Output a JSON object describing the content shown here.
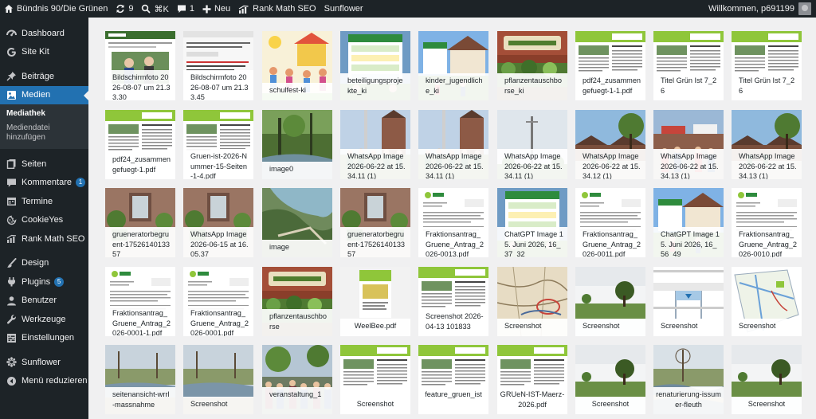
{
  "admin_bar": {
    "site_name": "Bündnis 90/Die Grünen",
    "updates_count": "9",
    "shortcut": "⌘K",
    "comments_count": "1",
    "new_label": "Neu",
    "rank_math_label": "Rank Math SEO",
    "sunflower_label": "Sunflower",
    "greeting": "Willkommen, p691199",
    "colors": {
      "background": "#1d2327",
      "text": "#f0f0f1"
    }
  },
  "sidebar": {
    "items": [
      {
        "label": "Dashboard",
        "icon": "dashboard-icon"
      },
      {
        "label": "Site Kit",
        "icon": "google-g-icon"
      },
      {
        "label": "Beiträge",
        "icon": "pushpin-icon"
      },
      {
        "label": "Medien",
        "icon": "media-icon",
        "current": true
      },
      {
        "label": "Seiten",
        "icon": "pages-icon"
      },
      {
        "label": "Kommentare",
        "icon": "comment-icon",
        "badge": "1"
      },
      {
        "label": "Termine",
        "icon": "calendar-icon"
      },
      {
        "label": "CookieYes",
        "icon": "cookie-icon"
      },
      {
        "label": "Rank Math SEO",
        "icon": "rank-math-icon"
      },
      {
        "label": "Design",
        "icon": "paintbrush-icon"
      },
      {
        "label": "Plugins",
        "icon": "plugin-icon",
        "badge": "5"
      },
      {
        "label": "Benutzer",
        "icon": "user-icon"
      },
      {
        "label": "Werkzeuge",
        "icon": "wrench-icon"
      },
      {
        "label": "Einstellungen",
        "icon": "settings-icon"
      },
      {
        "label": "Sunflower",
        "icon": "sunflower-icon"
      },
      {
        "label": "Menü reduzieren",
        "icon": "collapse-icon"
      }
    ],
    "submenu": [
      {
        "label": "Mediathek",
        "current": true
      },
      {
        "label": "Mediendatei hinzufügen"
      }
    ],
    "colors": {
      "background": "#1d2327",
      "current": "#2271b1",
      "submenu_bg": "#2c3338",
      "badge": "#2271b1"
    }
  },
  "media_grid": {
    "items": [
      {
        "name": "Bildschirmfoto 2026-08-07 um 21.33.30",
        "thumb": "screenshot-website"
      },
      {
        "name": "Bildschirmfoto 2026-08-07 um 21.33.45",
        "thumb": "screenshot-text"
      },
      {
        "name": "schulfest-ki",
        "thumb": "children-drawing"
      },
      {
        "name": "beteiligungsprojekte_ki",
        "thumb": "poster-projects"
      },
      {
        "name": "kinder_jugendliche_ki",
        "thumb": "house-poster"
      },
      {
        "name": "pflanzentauschborse_ki",
        "thumb": "plant-swap-sign"
      },
      {
        "name": "pdf24_zusammengefuegt-1-1.pdf",
        "thumb": "newsletter-doc"
      },
      {
        "name": "Titel Grün Ist 7_26",
        "thumb": "newsletter-doc"
      },
      {
        "name": "Titel Grün Ist 7_26",
        "thumb": "newsletter-doc"
      },
      {
        "name": "pdf24_zusammengefuegt-1.pdf",
        "thumb": "newsletter-doc"
      },
      {
        "name": "Gruen-ist-2026-Nummer-15-Seiten-1-4.pdf",
        "thumb": "newsletter-doc"
      },
      {
        "name": "image0",
        "thumb": "forest-river"
      },
      {
        "name": "WhatsApp Image 2026-06-22 at 15.34.11 (1)",
        "thumb": "group-church"
      },
      {
        "name": "WhatsApp Image 2026-06-22 at 15.34.11 (1)",
        "thumb": "group-church"
      },
      {
        "name": "WhatsApp Image 2026-06-22 at 15.34.11 (1)",
        "thumb": "mast-sky"
      },
      {
        "name": "WhatsApp Image 2026-06-22 at 15.34.12 (1)",
        "thumb": "tree-houses"
      },
      {
        "name": "WhatsApp Image 2026-06-22 at 15.34.13 (1)",
        "thumb": "crowd-market"
      },
      {
        "name": "WhatsApp Image 2026-06-22 at 15.34.13 (1)",
        "thumb": "tree-houses"
      },
      {
        "name": "grueneratorbegruent-1752614013357",
        "thumb": "green-building"
      },
      {
        "name": "WhatsApp Image 2026-06-15 at 16.05.37",
        "thumb": "green-building"
      },
      {
        "name": "image",
        "thumb": "aerial-view"
      },
      {
        "name": "grueneratorbegruent-1752614013357",
        "thumb": "green-building"
      },
      {
        "name": "Fraktionsantrag_Gruene_Antrag_2026-0013.pdf",
        "thumb": "doc-letter"
      },
      {
        "name": "ChatGPT Image 15. Juni 2026, 16_37_32",
        "thumb": "poster-projects"
      },
      {
        "name": "Fraktionsantrag_Gruene_Antrag_2026-0011.pdf",
        "thumb": "doc-letter"
      },
      {
        "name": "ChatGPT Image 15. Juni 2026, 16_56_49",
        "thumb": "house-poster"
      },
      {
        "name": "Fraktionsantrag_Gruene_Antrag_2026-0010.pdf",
        "thumb": "doc-letter"
      },
      {
        "name": "Fraktionsantrag_Gruene_Antrag_2026-0001-1.pdf",
        "thumb": "doc-letter"
      },
      {
        "name": "Fraktionsantrag_Gruene_Antrag_2026-0001.pdf",
        "thumb": "doc-letter"
      },
      {
        "name": "pflanzentauschborse",
        "thumb": "plant-swap-sign"
      },
      {
        "name": "WeelBee.pdf",
        "thumb": "flyer-doc",
        "center": true
      },
      {
        "name": "Screenshot 2026-04-13 101833",
        "thumb": "newsletter-doc"
      },
      {
        "name": "Screenshot",
        "thumb": "old-map"
      },
      {
        "name": "Screenshot",
        "thumb": "field-tree"
      },
      {
        "name": "Screenshot",
        "thumb": "road-diagram"
      },
      {
        "name": "Screenshot",
        "thumb": "site-plan"
      },
      {
        "name": "seitenansicht-wrrl-massnahme",
        "thumb": "river-bank"
      },
      {
        "name": "Screenshot",
        "thumb": "river-bank"
      },
      {
        "name": "veranstaltung_1",
        "thumb": "crowd-outdoor"
      },
      {
        "name": "Screenshot",
        "thumb": "newsletter-doc",
        "center": true
      },
      {
        "name": "feature_gruen_ist",
        "thumb": "newsletter-doc",
        "center": true
      },
      {
        "name": "GRUeN-IST-Maerz-2026.pdf",
        "thumb": "newsletter-doc",
        "center": true
      },
      {
        "name": "Screenshot",
        "thumb": "field-tree",
        "center": true
      },
      {
        "name": "renaturierung-issumer-fleuth",
        "thumb": "renaturation",
        "center": true
      },
      {
        "name": "Screenshot",
        "thumb": "field-tree",
        "center": true
      }
    ]
  }
}
